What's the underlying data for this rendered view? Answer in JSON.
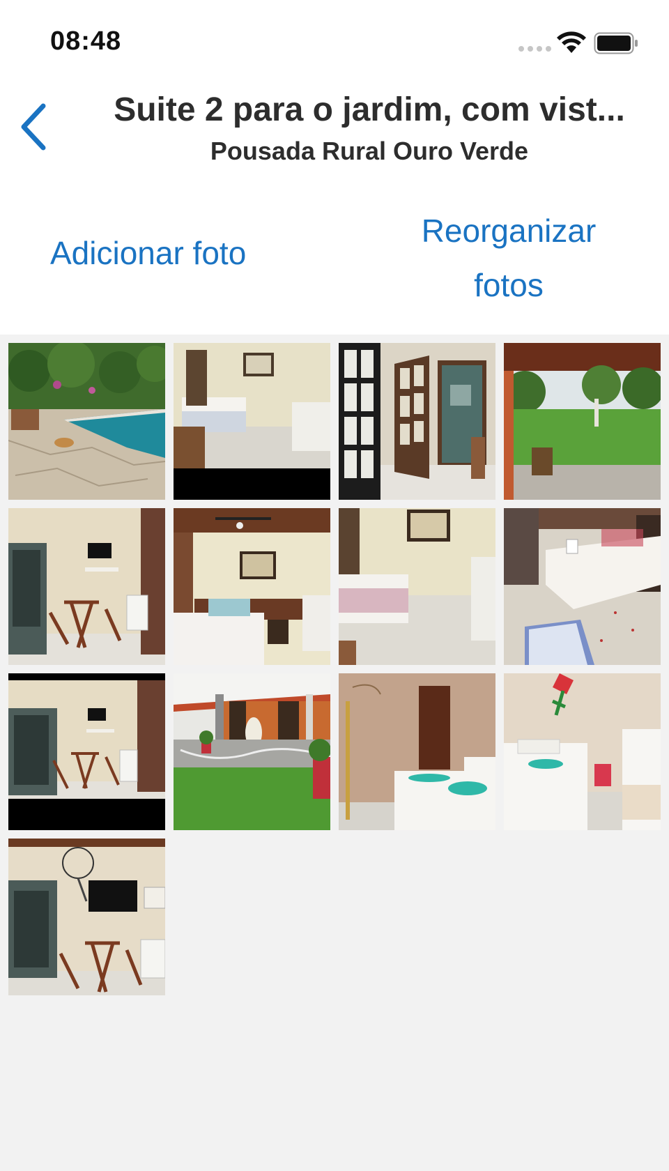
{
  "status_bar": {
    "time": "08:48",
    "icons": [
      "cellular-signal-icon",
      "wifi-icon",
      "battery-icon"
    ]
  },
  "nav": {
    "back_icon": "chevron-left-icon",
    "title": "Suite 2 para o jardim, com vist...",
    "subtitle": "Pousada Rural Ouro Verde"
  },
  "actions": {
    "add_photo": "Adicionar foto",
    "reorganize_line1": "Reorganizar",
    "reorganize_line2": "fotos"
  },
  "photos": [
    {
      "subject": "pool-patio"
    },
    {
      "subject": "bedroom-painting"
    },
    {
      "subject": "doors-bathroom"
    },
    {
      "subject": "veranda-lawn"
    },
    {
      "subject": "room-table-tv"
    },
    {
      "subject": "bedroom-fan"
    },
    {
      "subject": "bedroom-beds"
    },
    {
      "subject": "bed-rug"
    },
    {
      "subject": "room-table-tv-2"
    },
    {
      "subject": "veranda-hammock"
    },
    {
      "subject": "bedroom-teal-towels"
    },
    {
      "subject": "bedroom-flower-wall"
    },
    {
      "subject": "room-fan-tv-table"
    }
  ],
  "colors": {
    "accent": "#1a73c2",
    "header_bg": "#ffffff",
    "page_bg": "#f2f2f2"
  }
}
